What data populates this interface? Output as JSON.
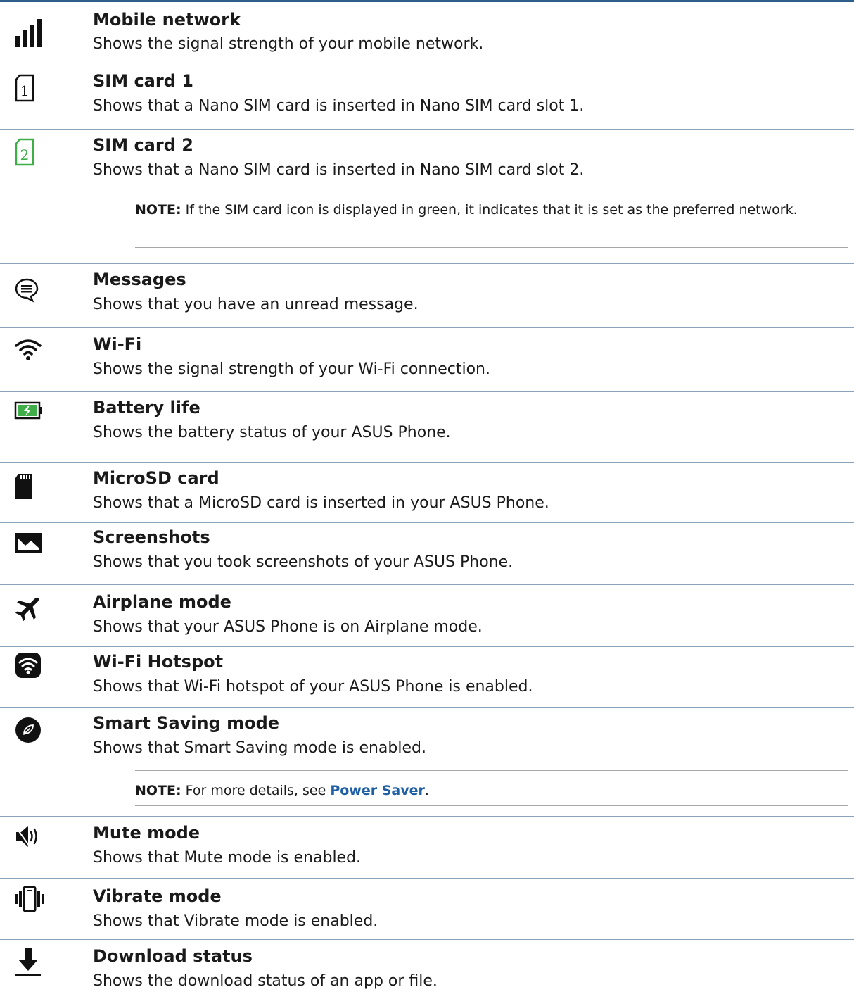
{
  "items": [
    {
      "icon": "signal-bars-icon",
      "title": "Mobile network",
      "desc": "Shows the signal strength of your mobile network."
    },
    {
      "icon": "sim-card-1-icon",
      "title": "SIM card 1",
      "desc": "Shows that a Nano SIM card is inserted in Nano SIM card slot 1."
    },
    {
      "icon": "sim-card-2-icon",
      "title": "SIM card 2",
      "desc": "Shows that a Nano SIM card is inserted in Nano SIM card slot 2."
    },
    {
      "icon": "messages-icon",
      "title": "Messages",
      "desc": "Shows that you have an unread message."
    },
    {
      "icon": "wifi-icon",
      "title": "Wi-Fi",
      "desc": "Shows the signal strength of your Wi-Fi connection."
    },
    {
      "icon": "battery-icon",
      "title": "Battery life",
      "desc": "Shows the battery status of your ASUS Phone."
    },
    {
      "icon": "microsd-card-icon",
      "title": "MicroSD card",
      "desc": "Shows that a MicroSD card is inserted in your ASUS Phone."
    },
    {
      "icon": "screenshot-icon",
      "title": "Screenshots",
      "desc": "Shows that you took screenshots of your ASUS Phone."
    },
    {
      "icon": "airplane-icon",
      "title": "Airplane mode",
      "desc": "Shows that your ASUS Phone is on Airplane mode."
    },
    {
      "icon": "wifi-hotspot-icon",
      "title": "Wi-Fi Hotspot",
      "desc": "Shows that Wi-Fi hotspot of your ASUS Phone is enabled."
    },
    {
      "icon": "smart-saving-icon",
      "title": "Smart Saving mode",
      "desc": "Shows that Smart Saving mode is enabled."
    },
    {
      "icon": "mute-icon",
      "title": "Mute mode",
      "desc": "Shows that Mute mode is enabled."
    },
    {
      "icon": "vibrate-icon",
      "title": "Vibrate mode",
      "desc": "Shows that Vibrate mode is enabled."
    },
    {
      "icon": "download-icon",
      "title": "Download status",
      "desc": "Shows the download status of an app or file."
    }
  ],
  "notes": {
    "sim_note_label": "NOTE:",
    "sim_note_text": "If the SIM card icon is displayed in green, it indicates that it is set as the preferred network.",
    "saver_note_label": "NOTE:",
    "saver_note_text": "For more details, see",
    "saver_note_link": "Power Saver",
    "saver_note_end": "."
  },
  "colors": {
    "top_rule": "#2e5f8a",
    "sim2_green": "#3fae49",
    "battery_green": "#3fae49",
    "link": "#1f5fa6"
  }
}
